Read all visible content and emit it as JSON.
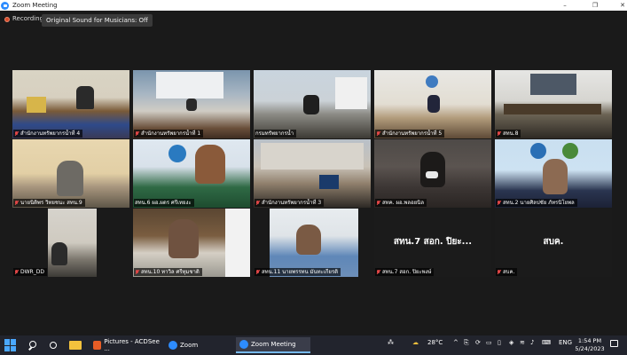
{
  "window": {
    "title": "Zoom Meeting",
    "controls": {
      "minimize": "–",
      "maximize": "❐",
      "close": "✕"
    }
  },
  "recording": {
    "label": "Recording",
    "sound_option": "Original Sound for Musicians: Off"
  },
  "participants": [
    {
      "name": "สำนักงานทรัพยากรน้ำที่ 4",
      "mic_muted": true,
      "video": true
    },
    {
      "name": "สำนักงานทรัพยากรน้ำที่ 1",
      "mic_muted": true,
      "video": true
    },
    {
      "name": "กรมทรัพยากรน้ำ",
      "mic_muted": false,
      "video": true,
      "active_speaker": true
    },
    {
      "name": "สำนักงานทรัพยากรน้ำที่ 5",
      "mic_muted": true,
      "video": true
    },
    {
      "name": "สทน.8",
      "mic_muted": true,
      "video": true
    },
    {
      "name": "นายนิติพร วิทยชนะ สทน.9",
      "mic_muted": true,
      "video": true
    },
    {
      "name": "สทน.6 ผอ.ผดร ศรีเทยงะ",
      "mic_muted": false,
      "video": true
    },
    {
      "name": "สำนักงานทรัพยากรน้ำที่ 3",
      "mic_muted": true,
      "video": true
    },
    {
      "name": "สทค. ผอ.พลอยนิล",
      "mic_muted": true,
      "video": true
    },
    {
      "name": "สทน.2 นายศิลปชัย ภัทรนิโยพล",
      "mic_muted": true,
      "video": true
    },
    {
      "name": "DWR_DD",
      "mic_muted": true,
      "video": true
    },
    {
      "name": "สทน.10 ทาวิล ศรีทุมชาติ",
      "mic_muted": true,
      "video": true
    },
    {
      "name": "สทน.11 นายพรรทน มันทะเกียรติ",
      "mic_muted": true,
      "video": true
    },
    {
      "name": "สทน.7 สอก. ปิยะพงษ์",
      "display_name": "สทน.7 สอก. ปิยะ...",
      "mic_muted": true,
      "video": false
    },
    {
      "name": "สบค.",
      "display_name": "สบค.",
      "mic_muted": true,
      "video": false
    }
  ],
  "taskbar": {
    "apps": [
      {
        "label": "Pictures - ACDSee ...",
        "icon": "acdsee-icon"
      },
      {
        "label": "Zoom",
        "icon": "zoom-icon"
      },
      {
        "label": "Zoom Meeting",
        "icon": "zoom-icon",
        "active": true
      }
    ],
    "weather": "28°C",
    "language": "ENG",
    "time": "1:54 PM",
    "date": "5/24/2023"
  },
  "colors": {
    "accent": "#2d8cff",
    "active_speaker_border": "#f0e000",
    "muted_mic": "#e04646",
    "background": "#1a1a1a"
  }
}
